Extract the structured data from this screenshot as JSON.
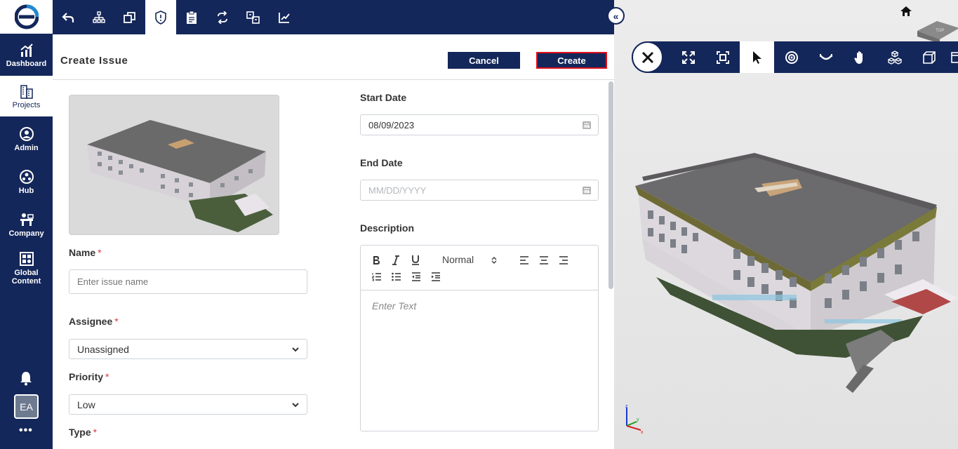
{
  "sidebar": {
    "items": [
      {
        "label": "Dashboard",
        "icon": "dashboard-icon"
      },
      {
        "label": "Projects",
        "icon": "building-icon"
      },
      {
        "label": "Admin",
        "icon": "admin-icon"
      },
      {
        "label": "Hub",
        "icon": "hub-icon"
      },
      {
        "label": "Company",
        "icon": "company-icon"
      },
      {
        "label": "Global Content",
        "icon": "global-content-icon"
      }
    ],
    "avatar_initials": "EA",
    "more": "•••"
  },
  "panel": {
    "title": "Create Issue",
    "cancel_label": "Cancel",
    "create_label": "Create"
  },
  "form": {
    "name_label": "Name",
    "name_placeholder": "Enter issue name",
    "assignee_label": "Assignee",
    "assignee_value": "Unassigned",
    "priority_label": "Priority",
    "priority_value": "Low",
    "type_label": "Type",
    "required_mark": "*",
    "start_date_label": "Start Date",
    "start_date_value": "08/09/2023",
    "end_date_label": "End Date",
    "end_date_placeholder": "MM/DD/YYYY",
    "description_label": "Description",
    "editor_format": "Normal",
    "editor_placeholder": "Enter Text"
  },
  "viewer": {
    "cube_label": "TOP",
    "axes": {
      "z": "z",
      "y": "y",
      "x": "x"
    }
  },
  "colors": {
    "navy": "#14275a",
    "required": "#d63a3a",
    "create_border": "#e0101b"
  }
}
